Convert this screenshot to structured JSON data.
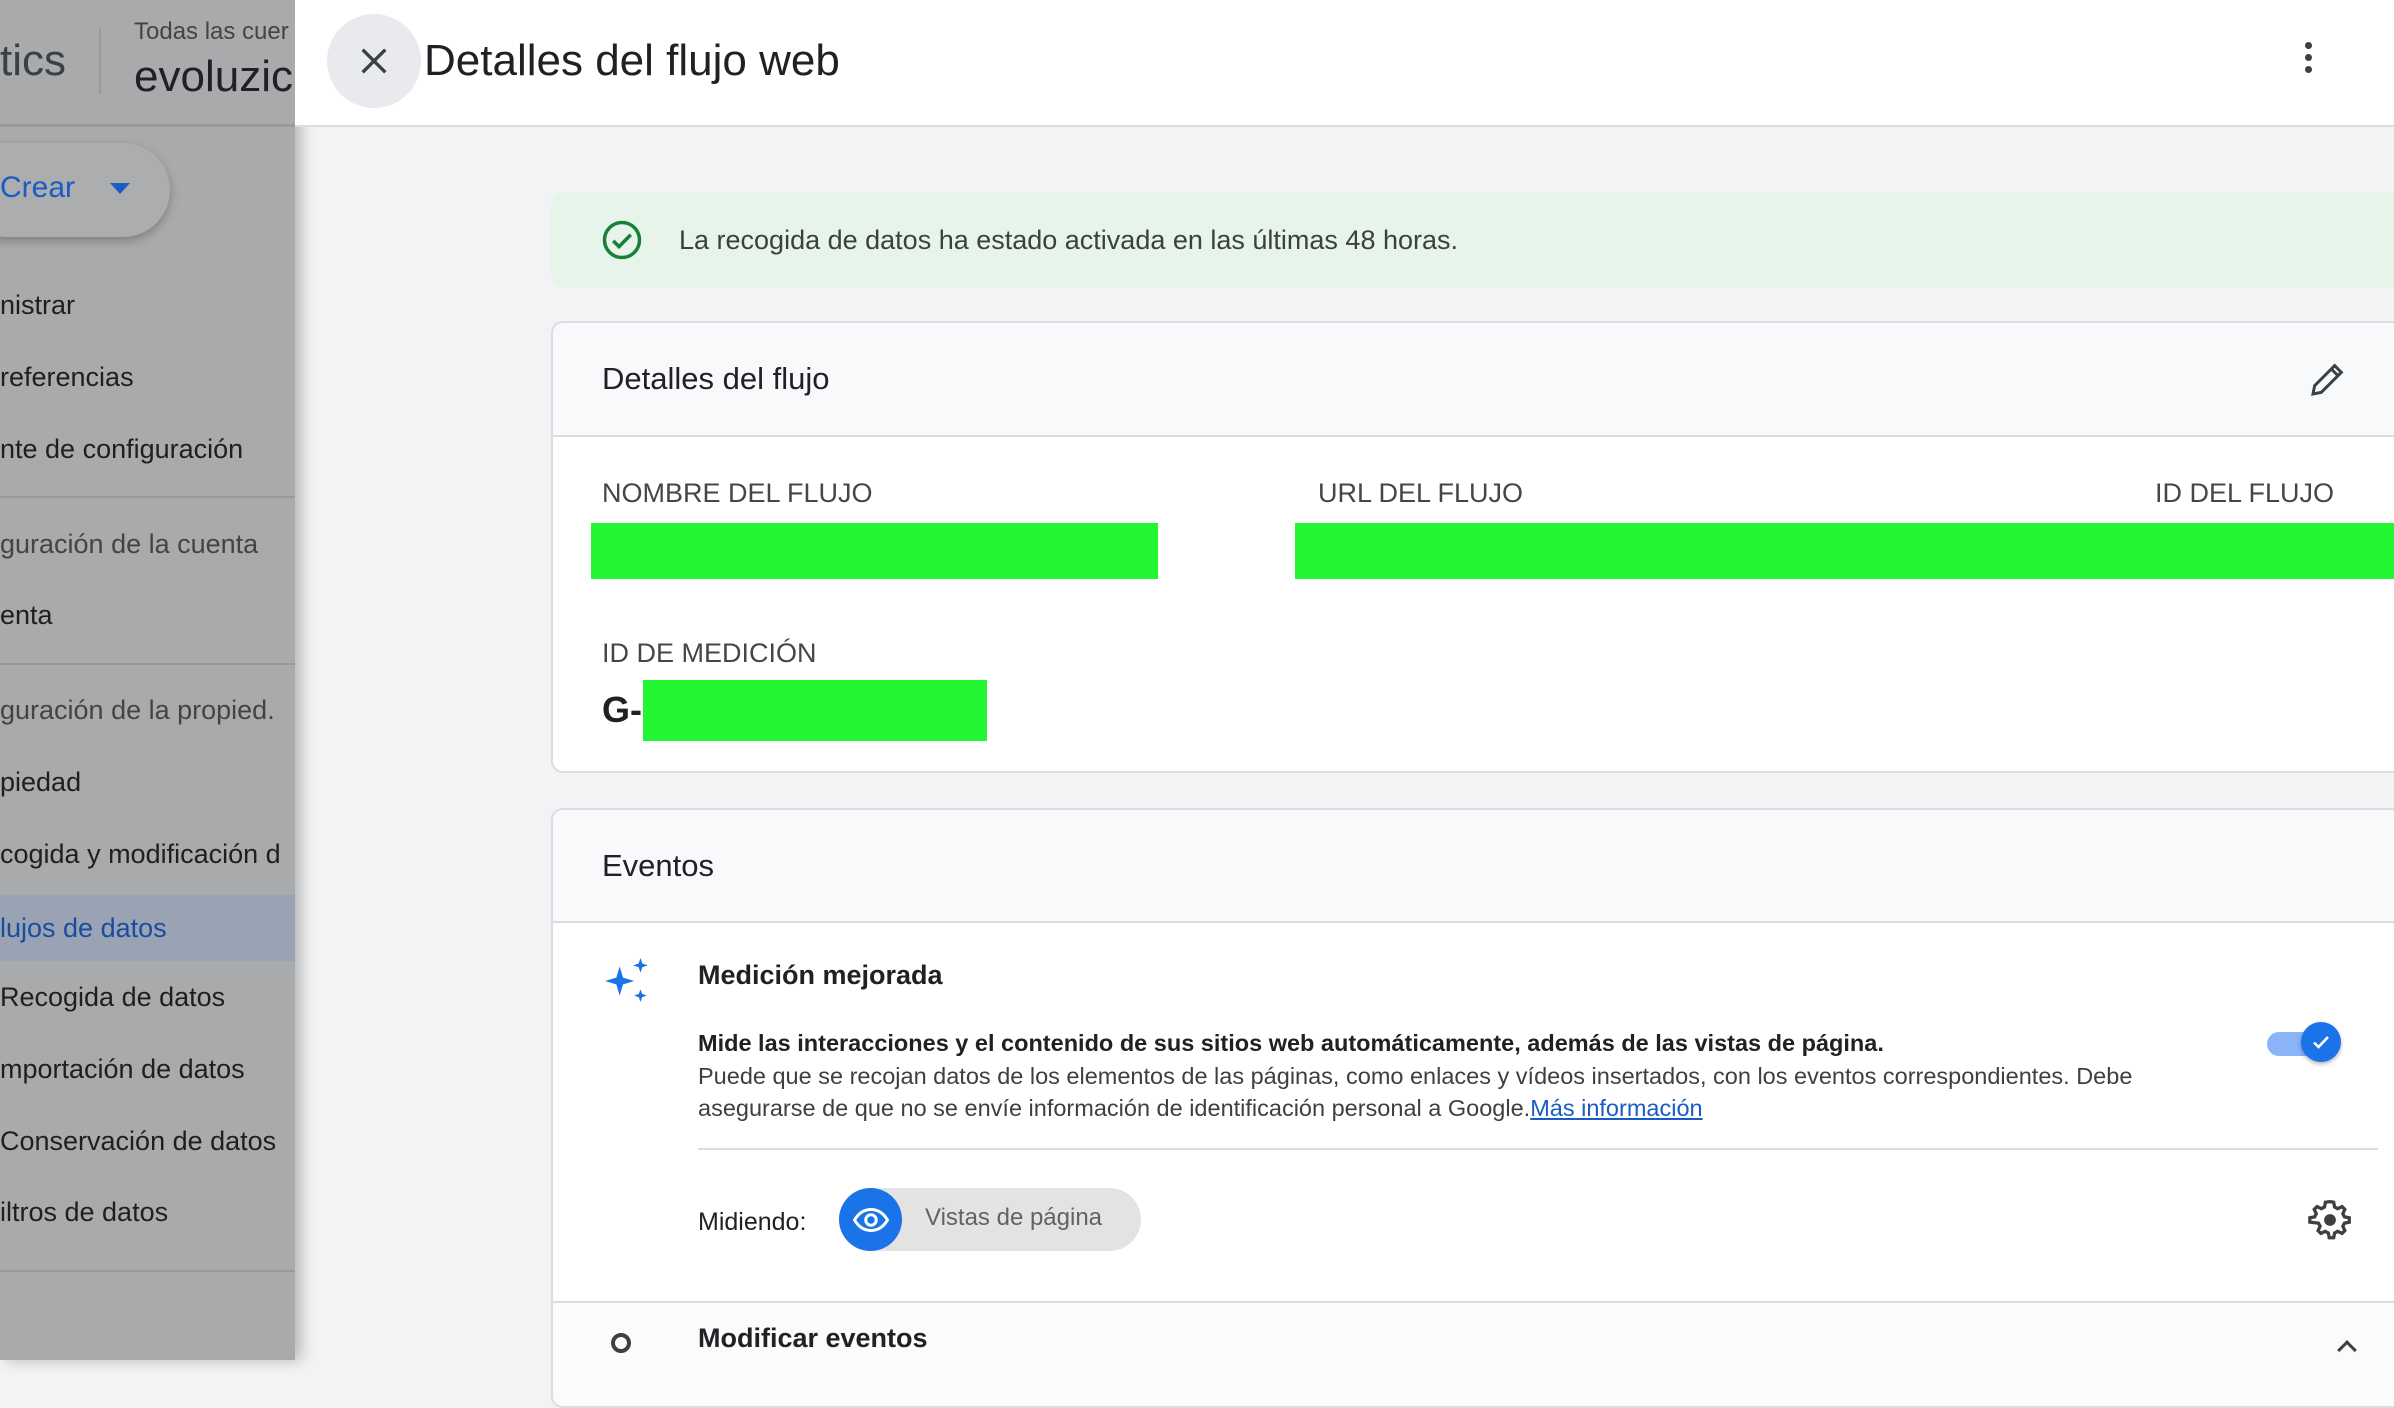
{
  "sidebar": {
    "app_name_fragment": "tics",
    "account_label": "Todas las cuer",
    "property_name": "evoluzic",
    "create_button": "Crear",
    "items": [
      {
        "label": "nistrar"
      },
      {
        "label": "referencias"
      },
      {
        "label": "nte de configuración"
      },
      {
        "label": "guración de la cuenta"
      },
      {
        "label": "enta"
      },
      {
        "label": "guración de la propied."
      },
      {
        "label": "piedad"
      },
      {
        "label": "cogida y modificación d"
      },
      {
        "label": "lujos de datos",
        "selected": true
      },
      {
        "label": "Recogida de datos"
      },
      {
        "label": "mportación de datos"
      },
      {
        "label": "Conservación de datos"
      },
      {
        "label": "iltros de datos"
      }
    ]
  },
  "panel": {
    "title": "Detalles del flujo web",
    "banner": "La recogida de datos ha estado activada en las últimas 48 horas.",
    "stream_details": {
      "title": "Detalles del flujo",
      "name_label": "NOMBRE DEL FLUJO",
      "url_label": "URL DEL FLUJO",
      "id_label": "ID DEL FLUJO",
      "measurement_label": "ID DE MEDICIÓN",
      "measurement_prefix": "G-"
    },
    "events": {
      "title": "Eventos",
      "enhanced_title": "Medición mejorada",
      "enhanced_bold": "Mide las interacciones y el contenido de sus sitios web automáticamente, además de las vistas de página.",
      "enhanced_desc_1": "Puede que se recojan datos de los elementos de las páginas, como enlaces y vídeos insertados, con los eventos correspondientes. Debe",
      "enhanced_desc_2": "asegurarse de que no se envíe información de identificación personal a Google.",
      "more_info_link": "Más información",
      "toggle_on": true,
      "measuring_label": "Midiendo:",
      "measuring_chip": "Vistas de página",
      "modify_events": "Modificar eventos"
    }
  },
  "colors": {
    "accent": "#1a73e8",
    "banner_bg": "#e6f4ea",
    "success": "#188038",
    "redaction": "#22f532"
  }
}
